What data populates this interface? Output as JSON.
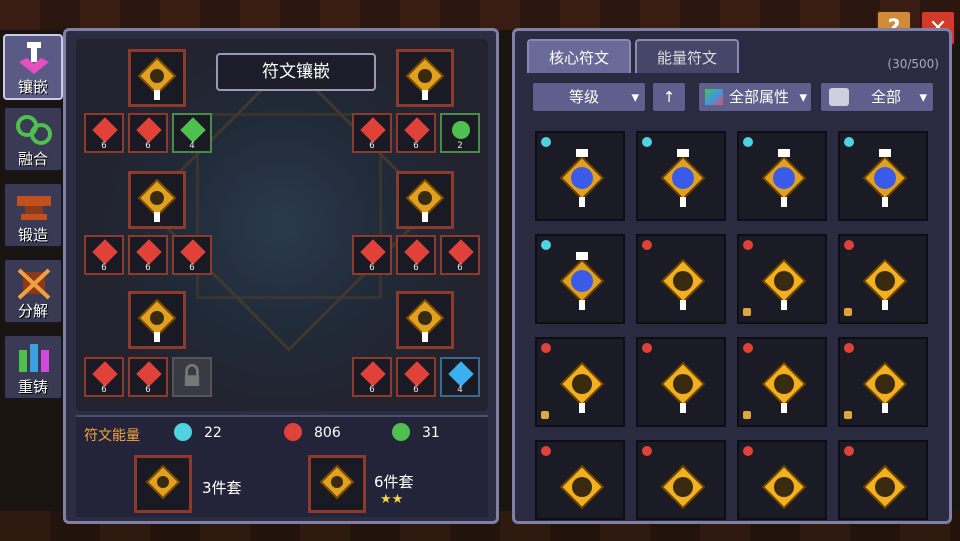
{
  "sidebar": {
    "items": [
      {
        "label": "镶嵌",
        "icon": "socket-icon",
        "active": true
      },
      {
        "label": "融合",
        "icon": "fuse-icon",
        "active": false
      },
      {
        "label": "锻造",
        "icon": "anvil-icon",
        "active": false
      },
      {
        "label": "分解",
        "icon": "decompose-icon",
        "active": false
      },
      {
        "label": "重铸",
        "icon": "crystal-icon",
        "active": false
      }
    ]
  },
  "left_panel": {
    "title": "符文镶嵌",
    "slot_counts": {
      "row1_left": [
        "6",
        "6",
        "4"
      ],
      "row1_right": [
        "6",
        "6",
        "2"
      ],
      "row2_left": [
        "6",
        "6",
        "6"
      ],
      "row2_right": [
        "6",
        "6",
        "6"
      ],
      "row3_left": [
        "6",
        "6"
      ],
      "row3_right": [
        "6",
        "6",
        "4"
      ]
    },
    "energy": {
      "label": "符文能量",
      "cyan": "22",
      "red": "806",
      "green": "31"
    },
    "sets": {
      "set3": "3件套",
      "set6": "6件套",
      "stars": "★★"
    }
  },
  "right_panel": {
    "tabs": [
      "核心符文",
      "能量符文"
    ],
    "count": "(30/500)",
    "filters": {
      "level": "等级",
      "attr": "全部属性",
      "all": "全部"
    }
  },
  "colors": {
    "accent_orange": "#f4a63a",
    "cyan_energy": "#4fd3e0",
    "red_energy": "#e0423a",
    "green_energy": "#4ec04e"
  }
}
